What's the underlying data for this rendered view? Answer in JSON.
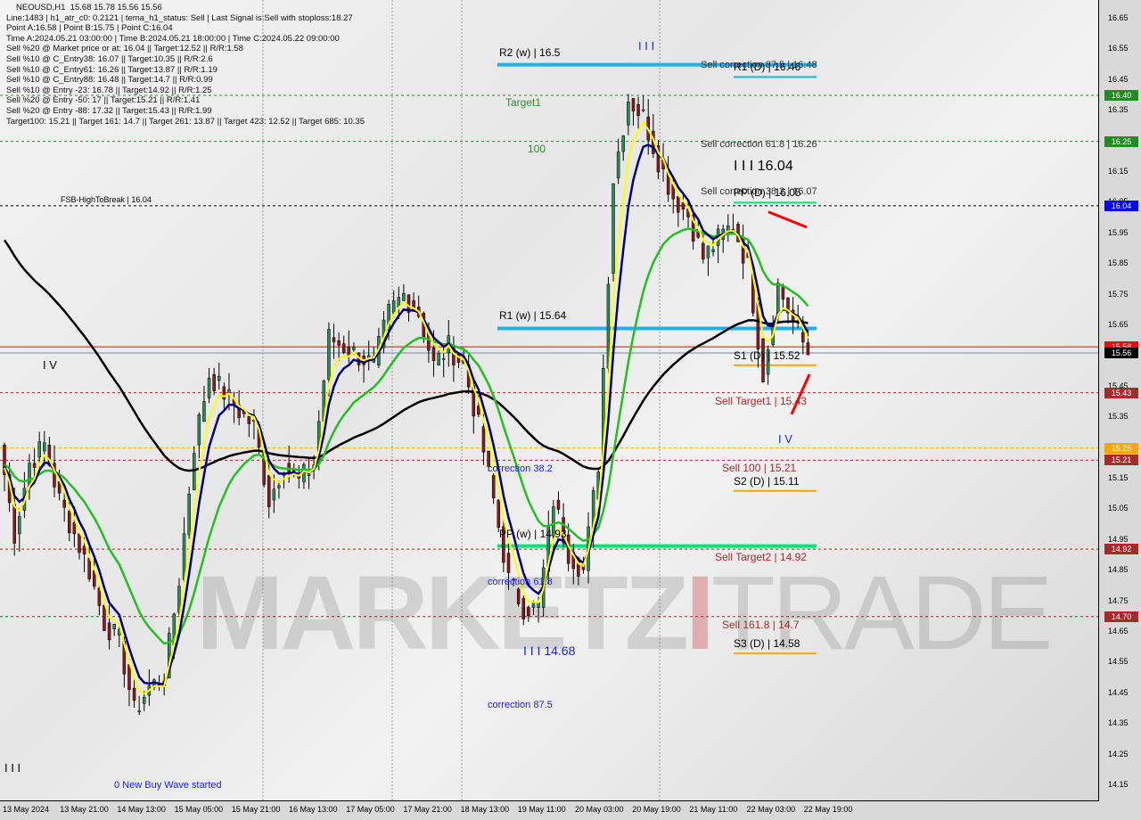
{
  "chart_data": {
    "type": "candlestick",
    "symbol": "NEOUSD,H1",
    "ohlc_header": "15.68 15.78 15.56 15.56",
    "ylim": [
      14.15,
      16.65
    ],
    "y_ticks": [
      16.65,
      16.55,
      16.45,
      16.35,
      16.25,
      16.15,
      16.05,
      15.95,
      15.85,
      15.75,
      15.65,
      15.55,
      15.45,
      15.35,
      15.25,
      15.15,
      15.05,
      14.95,
      14.85,
      14.75,
      14.65,
      14.55,
      14.45,
      14.35,
      14.25,
      14.15
    ],
    "x_ticks": [
      "13 May 2024",
      "13 May 21:00",
      "14 May 13:00",
      "15 May 05:00",
      "15 May 21:00",
      "16 May 13:00",
      "17 May 05:00",
      "17 May 21:00",
      "18 May 13:00",
      "19 May 11:00",
      "20 May 03:00",
      "20 May 19:00",
      "21 May 11:00",
      "22 May 03:00",
      "22 May 19:00"
    ],
    "closes": [
      15.26,
      14.97,
      15.2,
      15.26,
      15.08,
      14.97,
      14.85,
      14.68,
      14.62,
      14.39,
      14.47,
      14.5,
      14.82,
      15.26,
      15.49,
      15.43,
      15.37,
      15.32,
      15.08,
      15.2,
      15.14,
      15.2,
      15.61,
      15.58,
      15.55,
      15.52,
      15.69,
      15.75,
      15.69,
      15.52,
      15.58,
      15.52,
      15.32,
      15.08,
      14.82,
      14.73,
      14.73,
      15.08,
      14.91,
      14.85,
      15.2,
      16.13,
      16.39,
      16.33,
      16.19,
      16.07,
      16.01,
      15.87,
      15.93,
      15.98,
      15.84,
      15.49,
      15.78,
      15.66,
      15.56
    ],
    "price_tags": [
      {
        "value": "16.40",
        "color": "#228b22"
      },
      {
        "value": "16.25",
        "color": "#228b22"
      },
      {
        "value": "16.04",
        "color": "#0000ff"
      },
      {
        "value": "15.58",
        "color": "#ff0000"
      },
      {
        "value": "15.56",
        "color": "#000000"
      },
      {
        "value": "15.43",
        "color": "#a52a2a"
      },
      {
        "value": "15.25",
        "color": "#ffa500"
      },
      {
        "value": "15.21",
        "color": "#a52a2a"
      },
      {
        "value": "14.92",
        "color": "#a52a2a"
      },
      {
        "value": "14.70",
        "color": "#a52a2a"
      }
    ],
    "levels": [
      {
        "price": 16.5,
        "label": "R2 (w) | 16.5",
        "color": "#1ab4ea",
        "style": "weekly"
      },
      {
        "price": 16.46,
        "label": "R1 (D) | 16.46",
        "color": "#1ab4ea",
        "style": "daily"
      },
      {
        "price": 16.48,
        "label": "Sell correction 87.5 | 16.48",
        "color": "#333",
        "style": "text"
      },
      {
        "price": 16.4,
        "label": "Target1",
        "color": "#2e8b2e",
        "style": "green-dash"
      },
      {
        "price": 16.25,
        "label": "Sell correction 61.8 | 16.26",
        "color": "#2e8b2e",
        "style": "green-dash"
      },
      {
        "price": 16.04,
        "label": "FSB-HighToBreak | 16.04",
        "color": "#000",
        "style": "black-dash"
      },
      {
        "price": 16.05,
        "label": "PP (D) | 16.05",
        "color": "#00e676",
        "style": "daily"
      },
      {
        "price": 16.07,
        "label": "Sell correction 38.2 | 16.07",
        "color": "#333",
        "style": "text"
      },
      {
        "price": 15.64,
        "label": "R1 (w) | 15.64",
        "color": "#1ab4ea",
        "style": "weekly"
      },
      {
        "price": 15.58,
        "label": "",
        "color": "#ff0000",
        "style": "thin"
      },
      {
        "price": 15.56,
        "label": "",
        "color": "#7a8aa0",
        "style": "thin"
      },
      {
        "price": 15.52,
        "label": "S1 (D) | 15.52",
        "color": "#ffa500",
        "style": "daily"
      },
      {
        "price": 15.43,
        "label": "Sell Target1 | 15.43",
        "color": "#a52a2a",
        "style": "brown-dash"
      },
      {
        "price": 15.25,
        "label": "",
        "color": "#ffa500",
        "style": "orange-dash"
      },
      {
        "price": 15.21,
        "label": "Sell 100 | 15.21",
        "color": "#a52a2a",
        "style": "brown-dash"
      },
      {
        "price": 15.11,
        "label": "S2 (D) | 15.11",
        "color": "#ffa500",
        "style": "daily"
      },
      {
        "price": 14.93,
        "label": "PP (w) | 14.93",
        "color": "#00e676",
        "style": "weekly"
      },
      {
        "price": 14.92,
        "label": "Sell Target2 | 14.92",
        "color": "#a52a2a",
        "style": "brown-dash"
      },
      {
        "price": 14.7,
        "label": "Sell 161.8 | 14.7",
        "color": "#a52a2a",
        "style": "brown-dash"
      },
      {
        "price": 14.58,
        "label": "S3 (D) | 14.58",
        "color": "#ffa500",
        "style": "daily"
      }
    ],
    "annotations": {
      "hundred": "100",
      "wave_iii_top": "I I I 16.04",
      "wave_iii_low": "I I I 14.68",
      "wave_iv_right": "I V",
      "wave_iv_left": "I V",
      "wave_iii_mark": "I I I",
      "wave_i_bottom": "I I I",
      "corr382": "correction 38.2",
      "corr618": "correction 61.8",
      "corr875": "correction 87.5",
      "new_wave": "0 New Buy Wave started"
    }
  },
  "info": {
    "lines": [
      "Line:1483 | h1_atr_c0: 0.2121 | tema_h1_status: Sell | Last Signal is:Sell with stoploss:18.27",
      "Point A:16.58 | Point B:15.75 | Point C:16.04",
      "Time A:2024.05.21 03:00:00 | Time B:2024.05.21 18:00:00 | Time C:2024.05.22 09:00:00",
      "Sell %20 @ Market price or at: 16.04 || Target:12.52 || R/R:1.58",
      "Sell %10 @ C_Entry38: 16.07 || Target:10.35 || R/R:2.6",
      "Sell %10 @ C_Entry61: 16.26 || Target:13.87 || R/R:1.19",
      "Sell %10 @ C_Entry88: 16.48 || Target:14.7 || R/R:0.99",
      "Sell %10 @ Entry -23: 16.78 || Target:14.92 || R/R:1.25",
      "Sell %20 @ Entry -50: 17 || Target:15.21 || R/R:1.41",
      "Sell %20 @ Entry -88: 17.32 || Target:15.43 || R/R:1.99",
      "Target100: 15.21 || Target 161: 14.7 || Target 261: 13.87 || Target 423: 12.52 || Target 685: 10.35"
    ]
  },
  "watermark": {
    "a": "MARKETZ",
    "b": "I",
    "c": "TRADE"
  }
}
